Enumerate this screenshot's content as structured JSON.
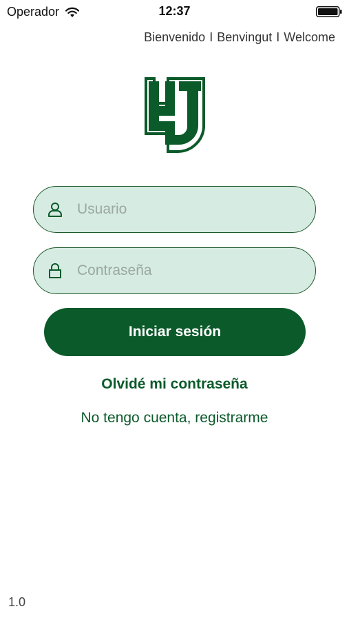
{
  "status_bar": {
    "carrier": "Operador",
    "time": "12:37",
    "wifi_icon": "wifi-icon",
    "battery_icon": "battery-icon"
  },
  "languages": {
    "spanish": "Bienvenido",
    "catalan": "Benvingut",
    "english": "Welcome",
    "separator": "I"
  },
  "logo": {
    "text": "HJ",
    "color": "#0b5a2a"
  },
  "login_form": {
    "username": {
      "placeholder": "Usuario",
      "value": "",
      "icon": "user-icon"
    },
    "password": {
      "placeholder": "Contraseña",
      "value": "",
      "icon": "lock-icon"
    },
    "submit_label": "Iniciar sesión",
    "forgot_password_label": "Olvidé mi contraseña",
    "register_label": "No tengo cuenta, registrarme"
  },
  "footer": {
    "version": "1.0"
  },
  "colors": {
    "primary": "#0b5a2a",
    "field_background": "#d6ebe2",
    "field_border": "#1d5a2b"
  }
}
